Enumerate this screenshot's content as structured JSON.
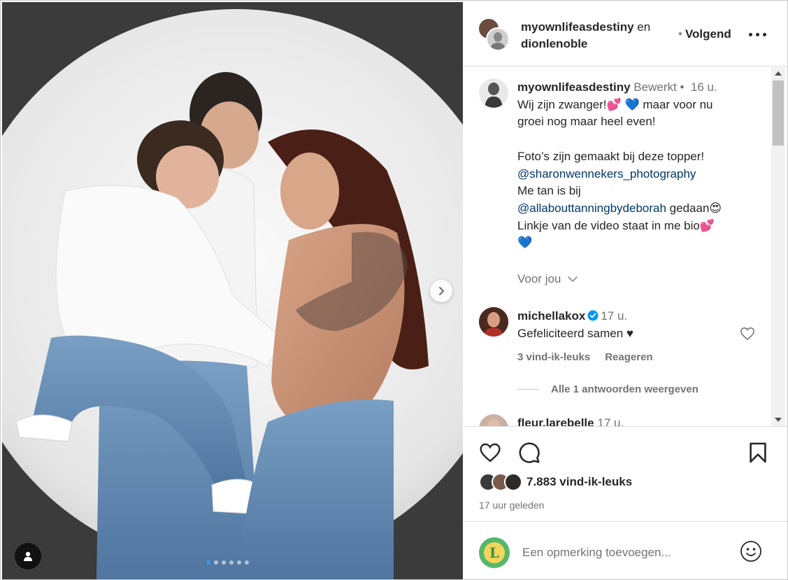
{
  "header": {
    "author": "myownlifeasdestiny",
    "connector": "en",
    "coauthor": "dionlenoble",
    "follow_bullet": "•",
    "follow_label": "Volgend"
  },
  "caption": {
    "username": "myownlifeasdestiny",
    "edited": "Bewerkt",
    "separator": "•",
    "time": "16 u.",
    "line1_a": "Wij zijn zwanger!",
    "line1_b": "maar voor nu",
    "line2": "groei nog maar heel even!",
    "line3": "Foto’s zijn gemaakt bij deze topper!",
    "mention1": "@sharonwennekers_photography",
    "line4": "Me tan is bij",
    "mention2": "@allabouttanningbydeborah",
    "line5_tail": "gedaan",
    "line6": "Linkje van de video staat in me bio"
  },
  "voor_jou": "Voor jou",
  "comments": [
    {
      "username": "michellakox",
      "time": "17 u.",
      "text": "Gefeliciteerd samen ♥",
      "likes": "3 vind-ik-leuks",
      "reply": "Reageren",
      "view_replies": "Alle 1 antwoorden weergeven"
    },
    {
      "username": "fleur.larebelle",
      "time": "17 u."
    }
  ],
  "likes": "7.883 vind-ik-leuks",
  "posted_ago": "17 uur geleden",
  "comment_input": {
    "placeholder": "Een opmerking toevoegen..."
  },
  "icons": [
    "chevron-right-icon",
    "user-tag-icon",
    "more-icon",
    "heart-icon",
    "comment-icon",
    "bookmark-icon",
    "emoji-icon",
    "verified-icon",
    "chevron-down-icon"
  ],
  "colors": {
    "link": "#00376b",
    "muted": "#737373",
    "text": "#262626",
    "active_dot": "#3897f0",
    "verified": "#0095f6"
  },
  "carousel": {
    "slides": 6,
    "active": 1
  }
}
